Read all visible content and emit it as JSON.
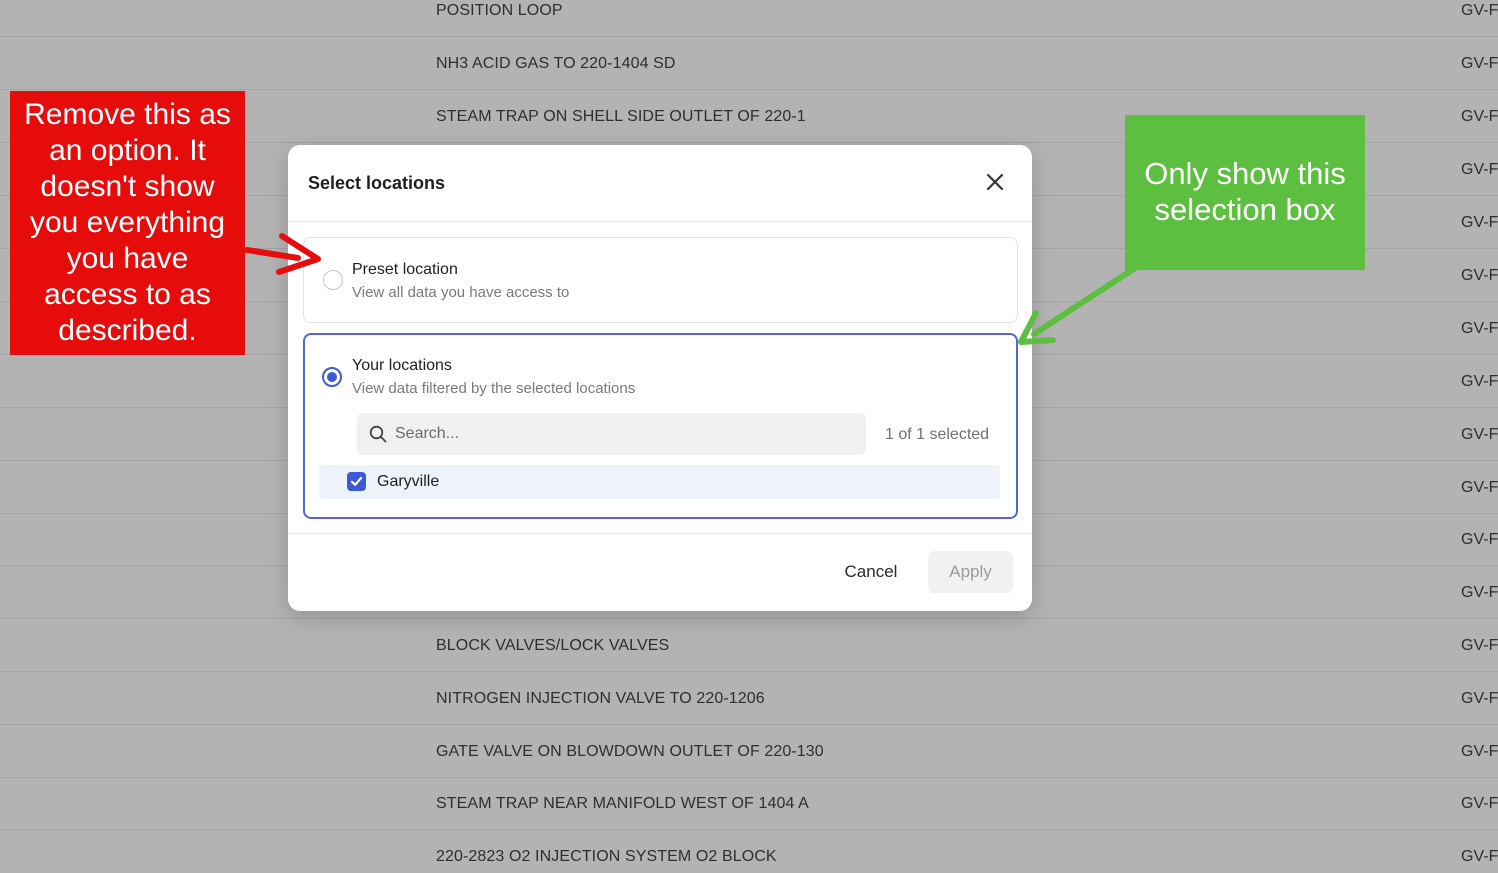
{
  "background_rows": [
    {
      "description": "POSITION LOOP",
      "code": "GV-F"
    },
    {
      "description": "NH3 ACID GAS TO 220-1404 SD",
      "code": "GV-F"
    },
    {
      "description": "STEAM TRAP ON SHELL SIDE OUTLET OF 220-1",
      "code": "GV-F"
    },
    {
      "description": "",
      "code": "GV-F"
    },
    {
      "description": "",
      "code": "GV-F"
    },
    {
      "description": "",
      "code": "GV-F"
    },
    {
      "description": "",
      "code": "GV-F"
    },
    {
      "description": "",
      "code": "GV-F"
    },
    {
      "description": "",
      "code": "GV-F"
    },
    {
      "description": "",
      "code": "GV-F"
    },
    {
      "description": "",
      "code": "GV-F"
    },
    {
      "description": "",
      "code": "GV-F"
    },
    {
      "description": "BLOCK VALVES/LOCK VALVES",
      "code": "GV-F"
    },
    {
      "description": "NITROGEN INJECTION VALVE TO 220-1206",
      "code": "GV-F"
    },
    {
      "description": "GATE VALVE ON BLOWDOWN OUTLET OF 220-130",
      "code": "GV-F"
    },
    {
      "description": "STEAM TRAP NEAR MANIFOLD WEST OF 1404 A",
      "code": "GV-F"
    },
    {
      "description": "220-2823 O2 INJECTION SYSTEM O2 BLOCK",
      "code": "GV-F"
    }
  ],
  "modal": {
    "title": "Select locations",
    "close_icon": "close-icon",
    "preset_option": {
      "label": "Preset location",
      "description": "View all data you have access to",
      "selected": false
    },
    "your_locations_option": {
      "label": "Your locations",
      "description": "View data filtered by the selected locations",
      "selected": true,
      "search_placeholder": "Search...",
      "search_value": "",
      "selected_count": "1 of 1 selected",
      "locations": [
        {
          "name": "Garyville",
          "checked": true
        }
      ]
    },
    "cancel_label": "Cancel",
    "apply_label": "Apply"
  },
  "annotations": {
    "red_note": [
      "Remove this as",
      "an option. It",
      "doesn't show",
      "you everything",
      "you have",
      "access to as",
      "described."
    ],
    "green_note": [
      "Only show this",
      "selection box"
    ],
    "red_color": "#e60c0c",
    "green_color": "#5cbf3f"
  },
  "colors": {
    "accent": "#3d5ad6",
    "overlay": "#b3b3b3"
  }
}
